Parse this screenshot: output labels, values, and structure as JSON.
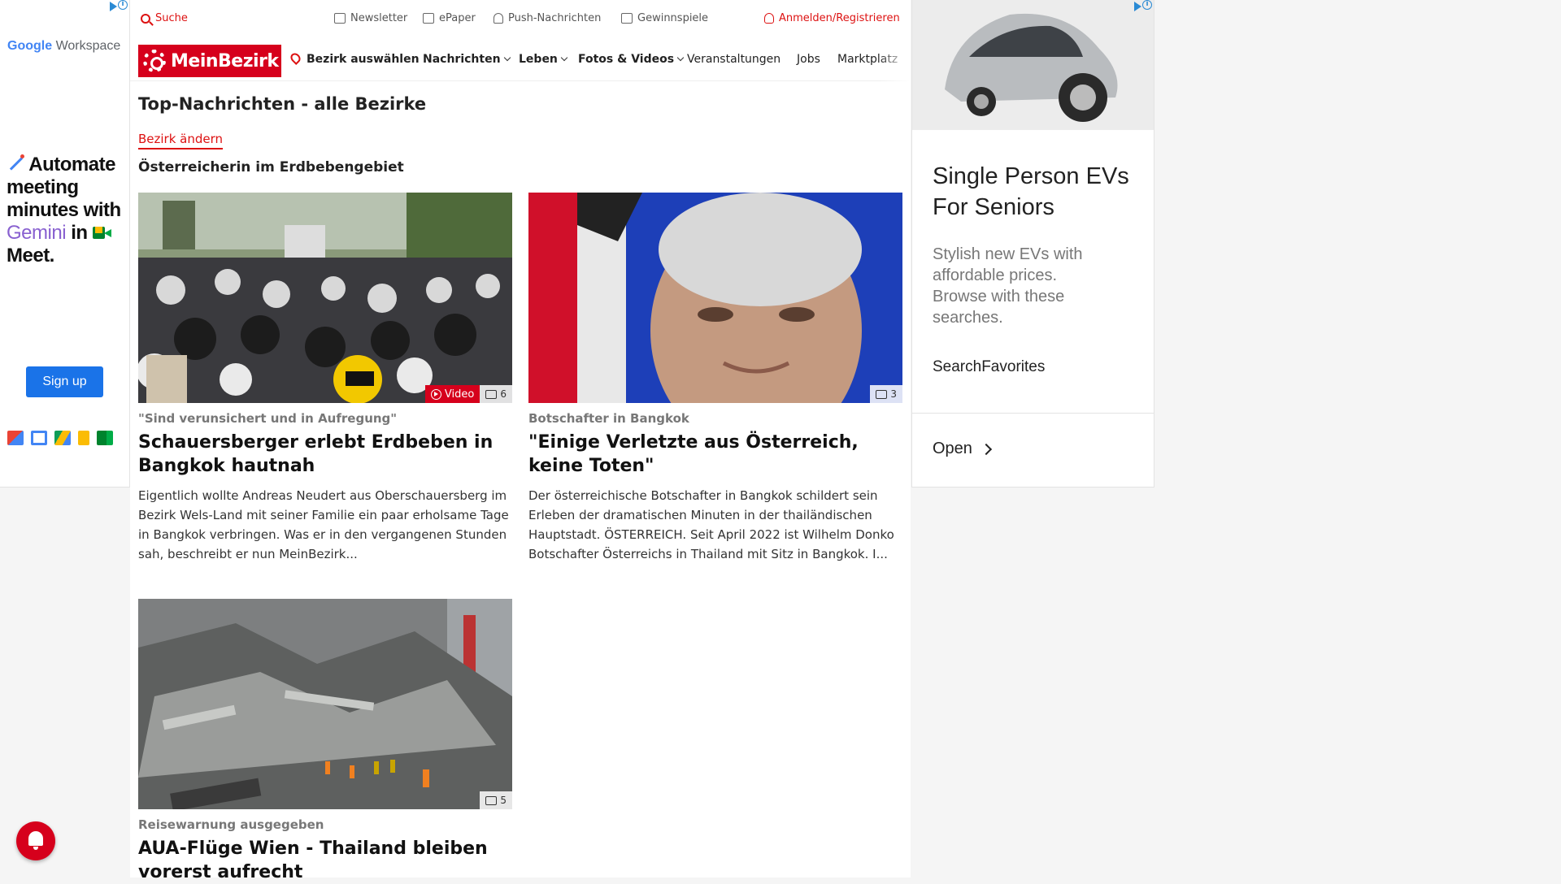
{
  "ad_left": {
    "brand_google": "Google",
    "brand_workspace": "Workspace",
    "headline_1": "Automate meeting minutes with",
    "headline_gemini": "Gemini",
    "headline_2": "in",
    "headline_3": "Meet.",
    "cta": "Sign up",
    "app_icons": [
      "gmail-icon",
      "calendar-icon",
      "drive-icon",
      "keep-icon",
      "meet-icon"
    ]
  },
  "topbar": {
    "search": "Suche",
    "newsletter": "Newsletter",
    "epaper": "ePaper",
    "push": "Push-Nachrichten",
    "games": "Gewinnspiele",
    "login": "Anmelden/Registrieren"
  },
  "nav": {
    "logo": "MeinBezirk",
    "bezirk_select": "Bezirk auswählen",
    "items": [
      "Nachrichten",
      "Leben",
      "Fotos & Videos",
      "Veranstaltungen",
      "Jobs",
      "Marktplatz"
    ]
  },
  "page": {
    "title": "Top-Nachrichten - alle Bezirke",
    "change_bezirk": "Bezirk ändern",
    "section": "Österreicherin im Erdbebengebiet"
  },
  "articles": [
    {
      "kicker": "\"Sind verunsichert und in Aufregung\"",
      "title": "Schauersberger erlebt Erdbeben in Bangkok hautnah",
      "teaser": "Eigentlich wollte Andreas Neudert aus Oberschauersberg im Bezirk Wels-Land mit seiner Familie ein paar erholsame Tage in Bangkok verbringen. Was er in den vergangenen Stunden sah, beschreibt er nun MeinBezirk...",
      "video_label": "Video",
      "photo_count": "6"
    },
    {
      "kicker": "Botschafter in Bangkok",
      "title": "\"Einige Verletzte aus Österreich, keine Toten\"",
      "teaser": "Der österreichische Botschafter in Bangkok schildert sein Erleben der dramatischen Minuten in der thailändischen Hauptstadt. ÖSTERREICH. Seit April 2022 ist Wilhelm Donko Botschafter Österreichs in Thailand mit Sitz in Bangkok. I...",
      "photo_count": "3"
    },
    {
      "kicker": "Reisewarnung ausgegeben",
      "title": "AUA-Flüge Wien - Thailand bleiben vorerst aufrecht",
      "photo_count": "5"
    }
  ],
  "ad_right": {
    "headline": "Single Person EVs For Seniors",
    "description": "Stylish new EVs with affordable prices. Browse with these searches.",
    "advertiser": "SearchFavorites",
    "cta": "Open"
  }
}
